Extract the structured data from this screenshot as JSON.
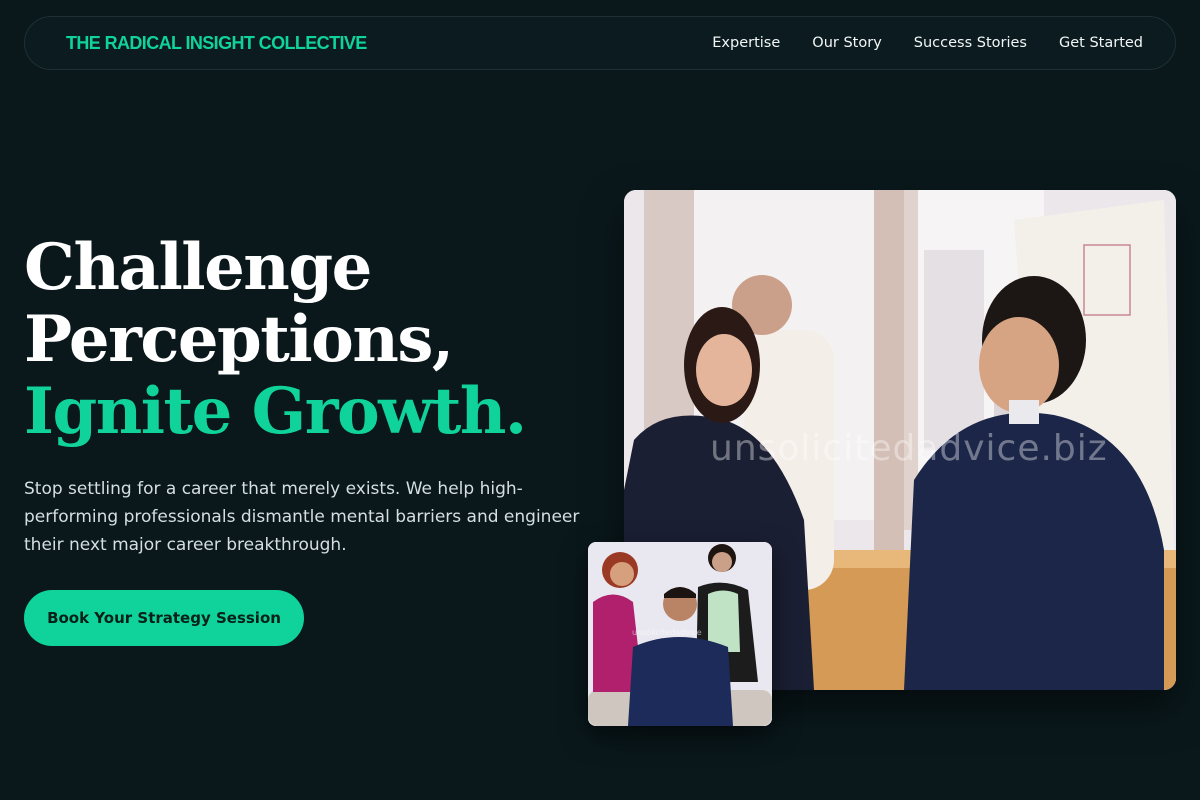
{
  "brand": {
    "name": "THE RADICAL INSIGHT COLLECTIVE"
  },
  "nav": {
    "items": [
      {
        "label": "Expertise"
      },
      {
        "label": "Our Story"
      },
      {
        "label": "Success Stories"
      },
      {
        "label": "Get Started"
      }
    ]
  },
  "hero": {
    "headline_line1": "Challenge",
    "headline_line2": "Perceptions,",
    "headline_accent": "Ignite Growth.",
    "subtext": "Stop settling for a career that merely exists. We help high-performing professionals dismantle mental barriers and engineer their next major career breakthrough.",
    "cta_label": "Book Your Strategy Session"
  },
  "images": {
    "main": {
      "alt": "Team of professionals talking by office window",
      "watermark": "unsolicitedadvice.biz"
    },
    "secondary": {
      "alt": "Three smiling professionals with arms crossed",
      "watermark": "unsolicitedadvice"
    }
  },
  "colors": {
    "background": "#0a181c",
    "accent": "#10d39b",
    "text": "#ffffff",
    "muted_text": "#d5dee0"
  }
}
